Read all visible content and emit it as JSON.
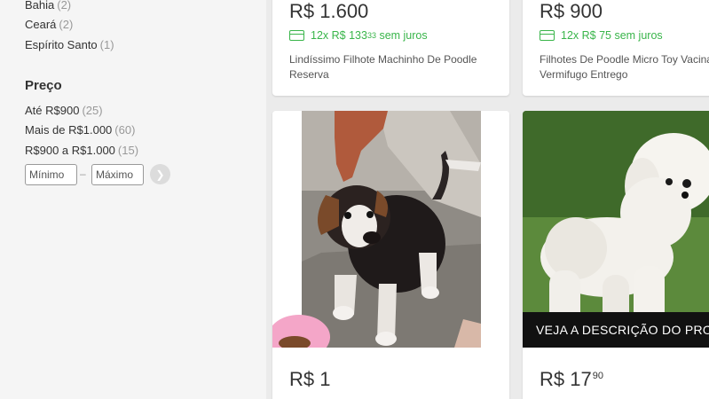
{
  "filters": {
    "states": [
      {
        "label": "Bahia",
        "count": "(2)"
      },
      {
        "label": "Ceará",
        "count": "(2)"
      },
      {
        "label": "Espírito Santo",
        "count": "(1)"
      }
    ],
    "price": {
      "title": "Preço",
      "options": [
        {
          "label": "Até R$900",
          "count": "(25)"
        },
        {
          "label": "Mais de R$1.000",
          "count": "(60)"
        },
        {
          "label": "R$900 a R$1.000",
          "count": "(15)"
        }
      ],
      "min_placeholder": "Mínimo",
      "max_placeholder": "Máximo",
      "dash": "–"
    }
  },
  "products": [
    {
      "price": "R$ 1.600",
      "installment_main": "12x R$ 133",
      "installment_cents": "33",
      "installment_suffix": "sem juros",
      "title": "Lindíssimo Filhote Machinho De Poodle Reserva"
    },
    {
      "price": "R$ 900",
      "installment_main": "12x R$ 75",
      "installment_suffix": "sem juros",
      "title": "Filhotes De Poodle Micro Toy Vacinado Vermifugo Entrego"
    },
    {
      "price_main": "R$ 1",
      "image_icon": "puppy-photo"
    },
    {
      "price_main": "R$ 17",
      "price_cents": "90",
      "banner": "VEJA A DESCRIÇÃO DO PRODUTO",
      "image_icon": "white-poodle-photo"
    }
  ],
  "colors": {
    "installment_green": "#39b54a",
    "background": "#ebebeb"
  }
}
